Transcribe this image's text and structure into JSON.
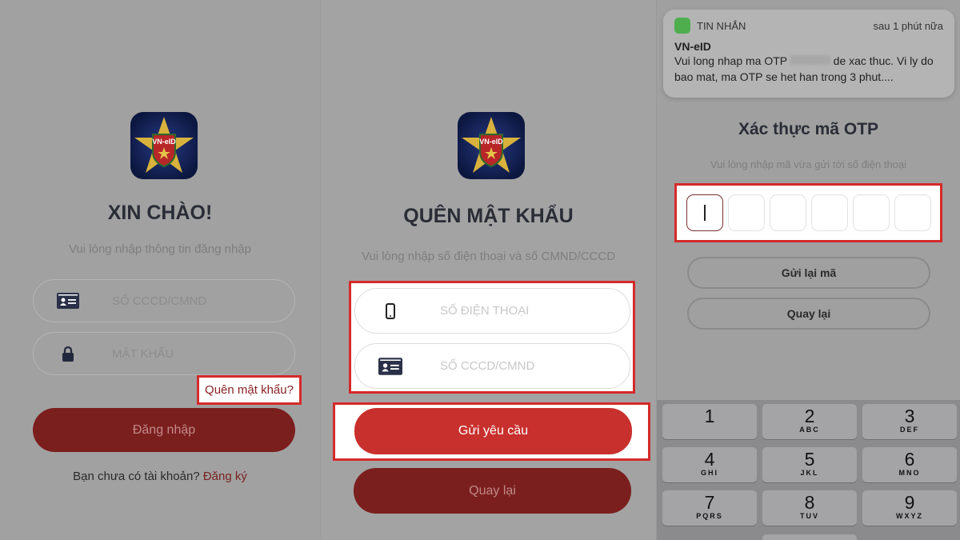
{
  "login": {
    "title": "XIN CHÀO!",
    "subtitle": "Vui lòng nhập thông tin đăng nhập",
    "id_placeholder": "SỐ CCCD/CMND",
    "password_placeholder": "MẬT KHẨU",
    "forgot_link": "Quên mật khẩu?",
    "login_button": "Đăng nhập",
    "no_account": "Bạn chưa có tài khoản?",
    "register_link": "Đăng ký"
  },
  "forgot": {
    "title": "QUÊN MẬT KHẨU",
    "subtitle": "Vui lòng nhập số điện thoại và số CMND/CCCD",
    "phone_placeholder": "SỐ ĐIỆN THOẠI",
    "id_placeholder": "SỐ CCCD/CMND",
    "submit_button": "Gửi yêu cầu",
    "back_button": "Quay lại"
  },
  "logo": {
    "text": "VN-eID"
  },
  "otp": {
    "notification": {
      "app": "TIN NHẮN",
      "time": "sau 1 phút nữa",
      "sender": "VN-eID",
      "body_before": "Vui long nhap ma OTP",
      "body_after": "de xac thuc. Vi ly do bao mat, ma OTP se het han trong 3 phut...."
    },
    "title": "Xác thực mã OTP",
    "subtitle": "Vui lòng nhập mã vừa gửi tới số điện thoại",
    "digits": 6,
    "resend_button": "Gửi lại mã",
    "back_button": "Quay lại"
  },
  "keypad": [
    {
      "n": "1",
      "l": ""
    },
    {
      "n": "2",
      "l": "ABC"
    },
    {
      "n": "3",
      "l": "DEF"
    },
    {
      "n": "4",
      "l": "GHI"
    },
    {
      "n": "5",
      "l": "JKL"
    },
    {
      "n": "6",
      "l": "MNO"
    },
    {
      "n": "7",
      "l": "PQRS"
    },
    {
      "n": "8",
      "l": "TUV"
    },
    {
      "n": "9",
      "l": "WXYZ"
    }
  ],
  "colors": {
    "highlight": "#d42a2a",
    "primary": "#c8302d",
    "primary_dimmed": "#7b1f1e"
  }
}
